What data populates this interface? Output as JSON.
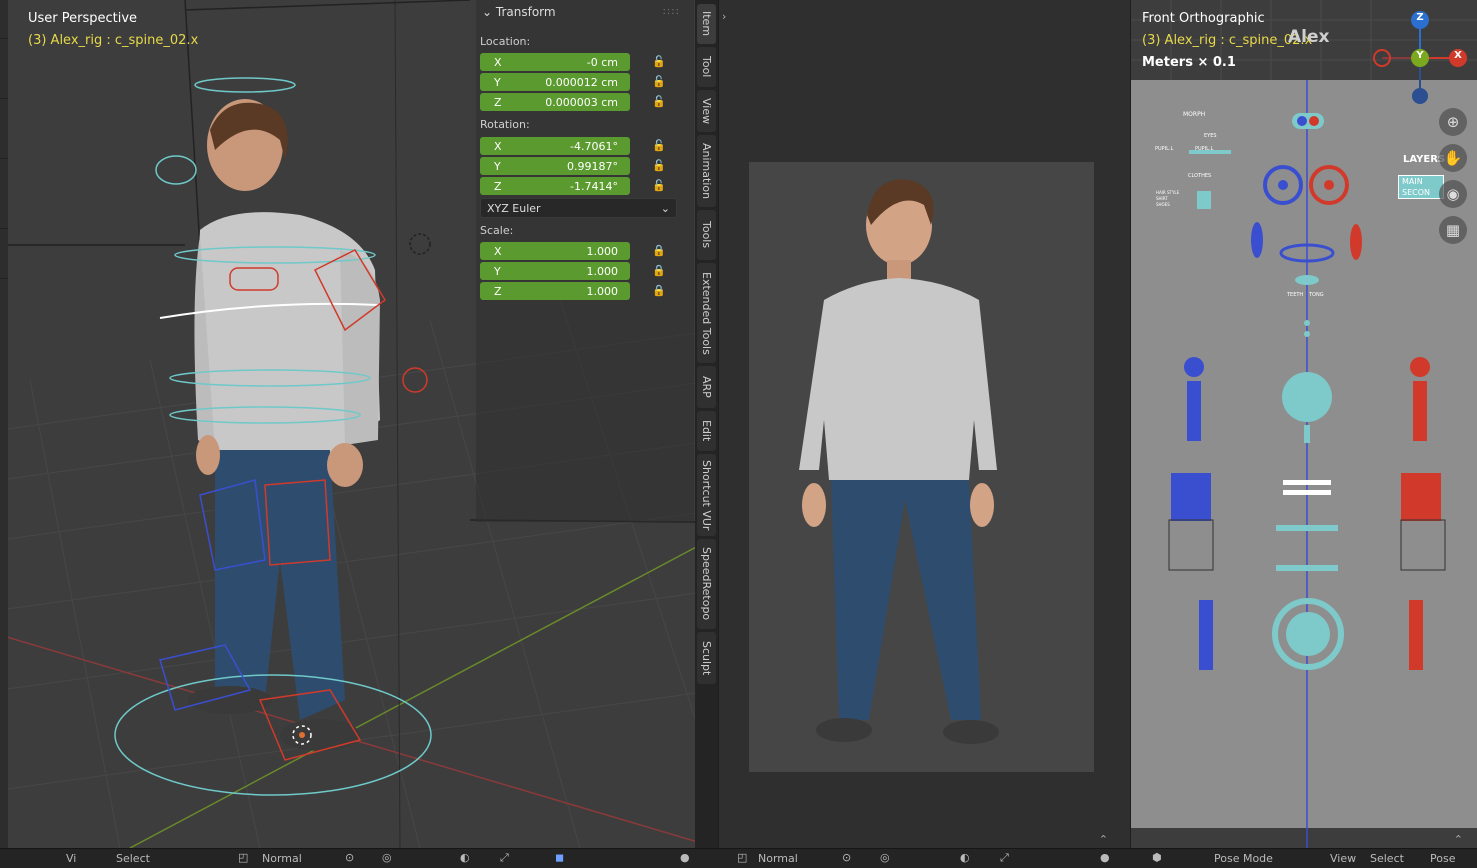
{
  "left_viewport": {
    "title": "User Perspective",
    "subtitle": "(3) Alex_rig : c_spine_02.x"
  },
  "transform_panel": {
    "header": "Transform",
    "location_label": "Location:",
    "location": [
      {
        "axis": "X",
        "value": "-0 cm"
      },
      {
        "axis": "Y",
        "value": "0.000012 cm"
      },
      {
        "axis": "Z",
        "value": "0.000003 cm"
      }
    ],
    "rotation_label": "Rotation:",
    "rotation": [
      {
        "axis": "X",
        "value": "-4.7061°"
      },
      {
        "axis": "Y",
        "value": "0.99187°"
      },
      {
        "axis": "Z",
        "value": "-1.7414°"
      }
    ],
    "rotation_mode": "XYZ Euler",
    "scale_label": "Scale:",
    "scale": [
      {
        "axis": "X",
        "value": "1.000"
      },
      {
        "axis": "Y",
        "value": "1.000"
      },
      {
        "axis": "Z",
        "value": "1.000"
      }
    ]
  },
  "sidebar_tabs": [
    "Item",
    "Tool",
    "View",
    "Animation",
    "Tools",
    "Extended Tools",
    "ARP",
    "Edit",
    "Shortcut VUr",
    "SpeedRetopo",
    "Sculpt"
  ],
  "right_viewport": {
    "title": "Front Orthographic",
    "subtitle": "(3) Alex_rig : c_spine_02.x",
    "overlay_name": "Alex",
    "grid_scale": "Meters × 0.1",
    "gizmo": {
      "z": "Z",
      "y": "Y",
      "x": "X"
    },
    "picker_labels": {
      "morph": "MORPH",
      "eyes": "EYES",
      "pupil_l": "PUPIL.L",
      "pupil_r": "PUPIL.L",
      "clothes": "CLOTHES",
      "hair": "HAIR STYLE",
      "shirt": "SHIRT",
      "shoes": "SHOES",
      "teeth": "TEETH",
      "tong": "TONG",
      "layers": "LAYERS",
      "main": "MAIN",
      "second": "SECON"
    }
  },
  "colors": {
    "field_green": "#5b9a2f",
    "picker_blue": "#3a4fd0",
    "picker_red": "#d13a2a",
    "picker_teal": "#7ec9c9",
    "subtitle_yellow": "#e8d94a"
  },
  "bottom_bar": {
    "left_view": "Vi",
    "left_select": "Select",
    "left_mode": "Normal",
    "mid_mode": "Normal",
    "right_mode": "Pose Mode",
    "right_view": "View",
    "right_select": "Select",
    "right_pose": "Pose"
  }
}
